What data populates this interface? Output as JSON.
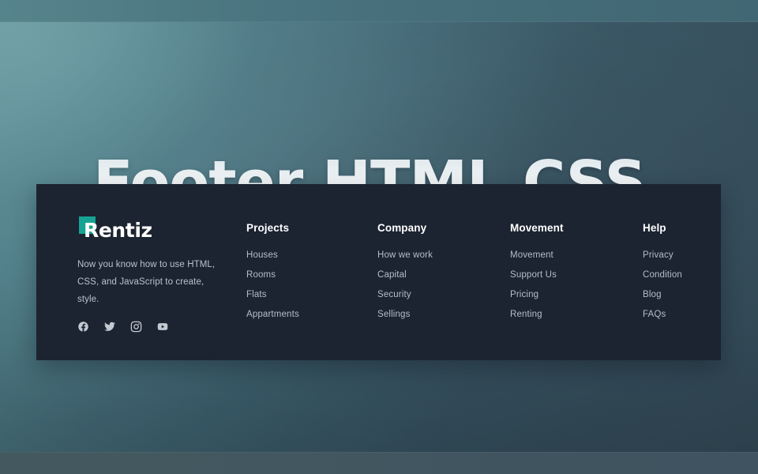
{
  "hero": {
    "title": "Footer HTML CSS"
  },
  "brand": {
    "logo_text": "Rentiz",
    "logo_mark": "teal-square",
    "description": "Now you know how to use HTML, CSS, and JavaScript to create, style.",
    "accent_color": "#16a394",
    "socials": [
      {
        "name": "facebook",
        "icon": "facebook-icon"
      },
      {
        "name": "twitter",
        "icon": "twitter-icon"
      },
      {
        "name": "instagram",
        "icon": "instagram-icon"
      },
      {
        "name": "youtube",
        "icon": "youtube-icon"
      }
    ]
  },
  "columns": [
    {
      "title": "Projects",
      "links": [
        "Houses",
        "Rooms",
        "Flats",
        "Appartments"
      ]
    },
    {
      "title": "Company",
      "links": [
        "How we work",
        "Capital",
        "Security",
        "Sellings"
      ]
    },
    {
      "title": "Movement",
      "links": [
        "Movement",
        "Support Us",
        "Pricing",
        "Renting"
      ]
    },
    {
      "title": "Help",
      "links": [
        "Privacy",
        "Condition",
        "Blog",
        "FAQs"
      ]
    }
  ],
  "theme": {
    "panel_bg": "#1c2431",
    "heading_color": "#ffffff",
    "link_color": "#b4bdc8",
    "page_bg_left": "#5c8d94",
    "page_bg_right": "#3e5866"
  }
}
